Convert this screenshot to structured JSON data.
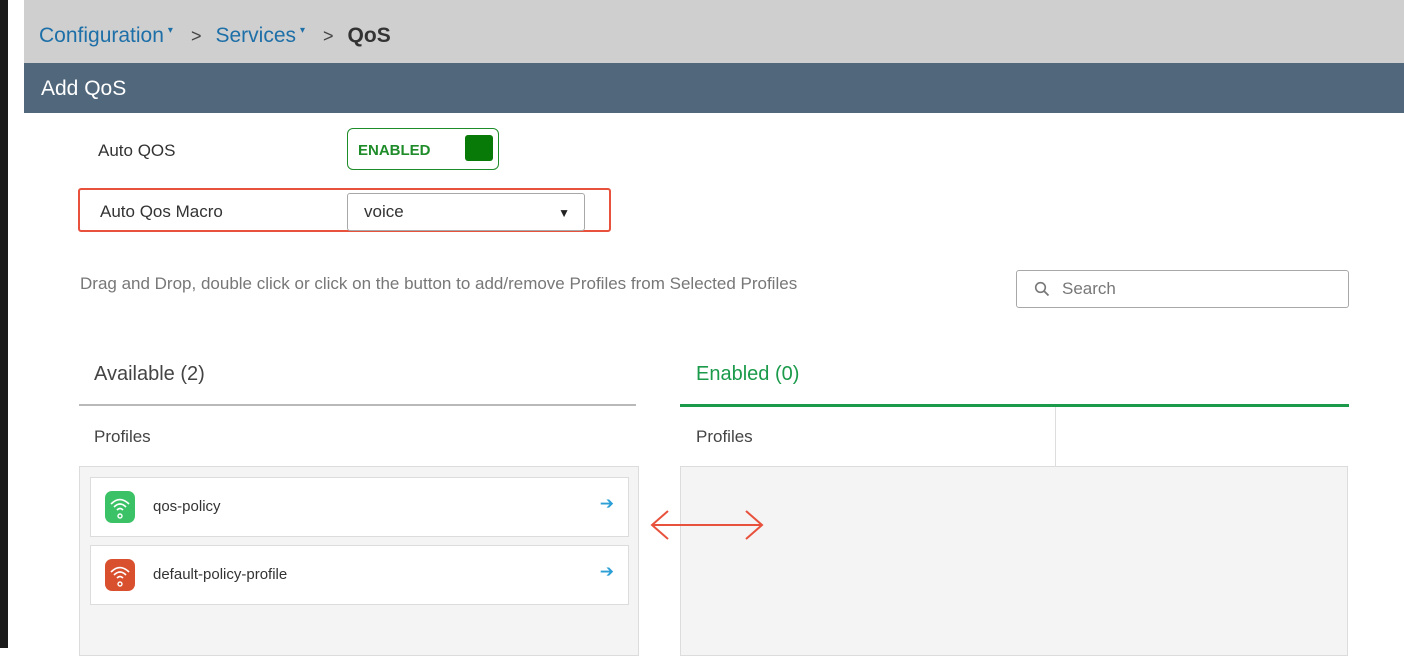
{
  "breadcrumb": {
    "items": [
      {
        "label": "Configuration",
        "caret": "▾"
      },
      {
        "label": "Services",
        "caret": "▾"
      }
    ],
    "separator": ">",
    "current": "QoS"
  },
  "header": {
    "title": "Add QoS"
  },
  "auto_qos": {
    "label": "Auto QOS",
    "toggle_text": "ENABLED",
    "toggle_on": true
  },
  "auto_qos_macro": {
    "label": "Auto Qos Macro",
    "selected": "voice",
    "highlight_color": "#e8523d"
  },
  "hint": "Drag and Drop, double click or click on the button to add/remove Profiles from Selected Profiles",
  "search": {
    "placeholder": "Search",
    "icon": "search-icon"
  },
  "available": {
    "title": "Available (2)",
    "column_header": "Profiles",
    "items": [
      {
        "label": "qos-policy",
        "icon": "wifi-icon",
        "icon_color": "#3cc266",
        "action_icon": "arrow-right-icon"
      },
      {
        "label": "default-policy-profile",
        "icon": "wifi-icon",
        "icon_color": "#d9502e",
        "action_icon": "arrow-right-icon"
      }
    ]
  },
  "enabled": {
    "title": "Enabled (0)",
    "column_header": "Profiles",
    "items": []
  },
  "colors": {
    "header_bg": "#51687c",
    "link": "#1d6fa8",
    "enabled_green": "#1a9a4a",
    "action_arrow": "#2b9fd6",
    "annotation": "#e8523d"
  }
}
